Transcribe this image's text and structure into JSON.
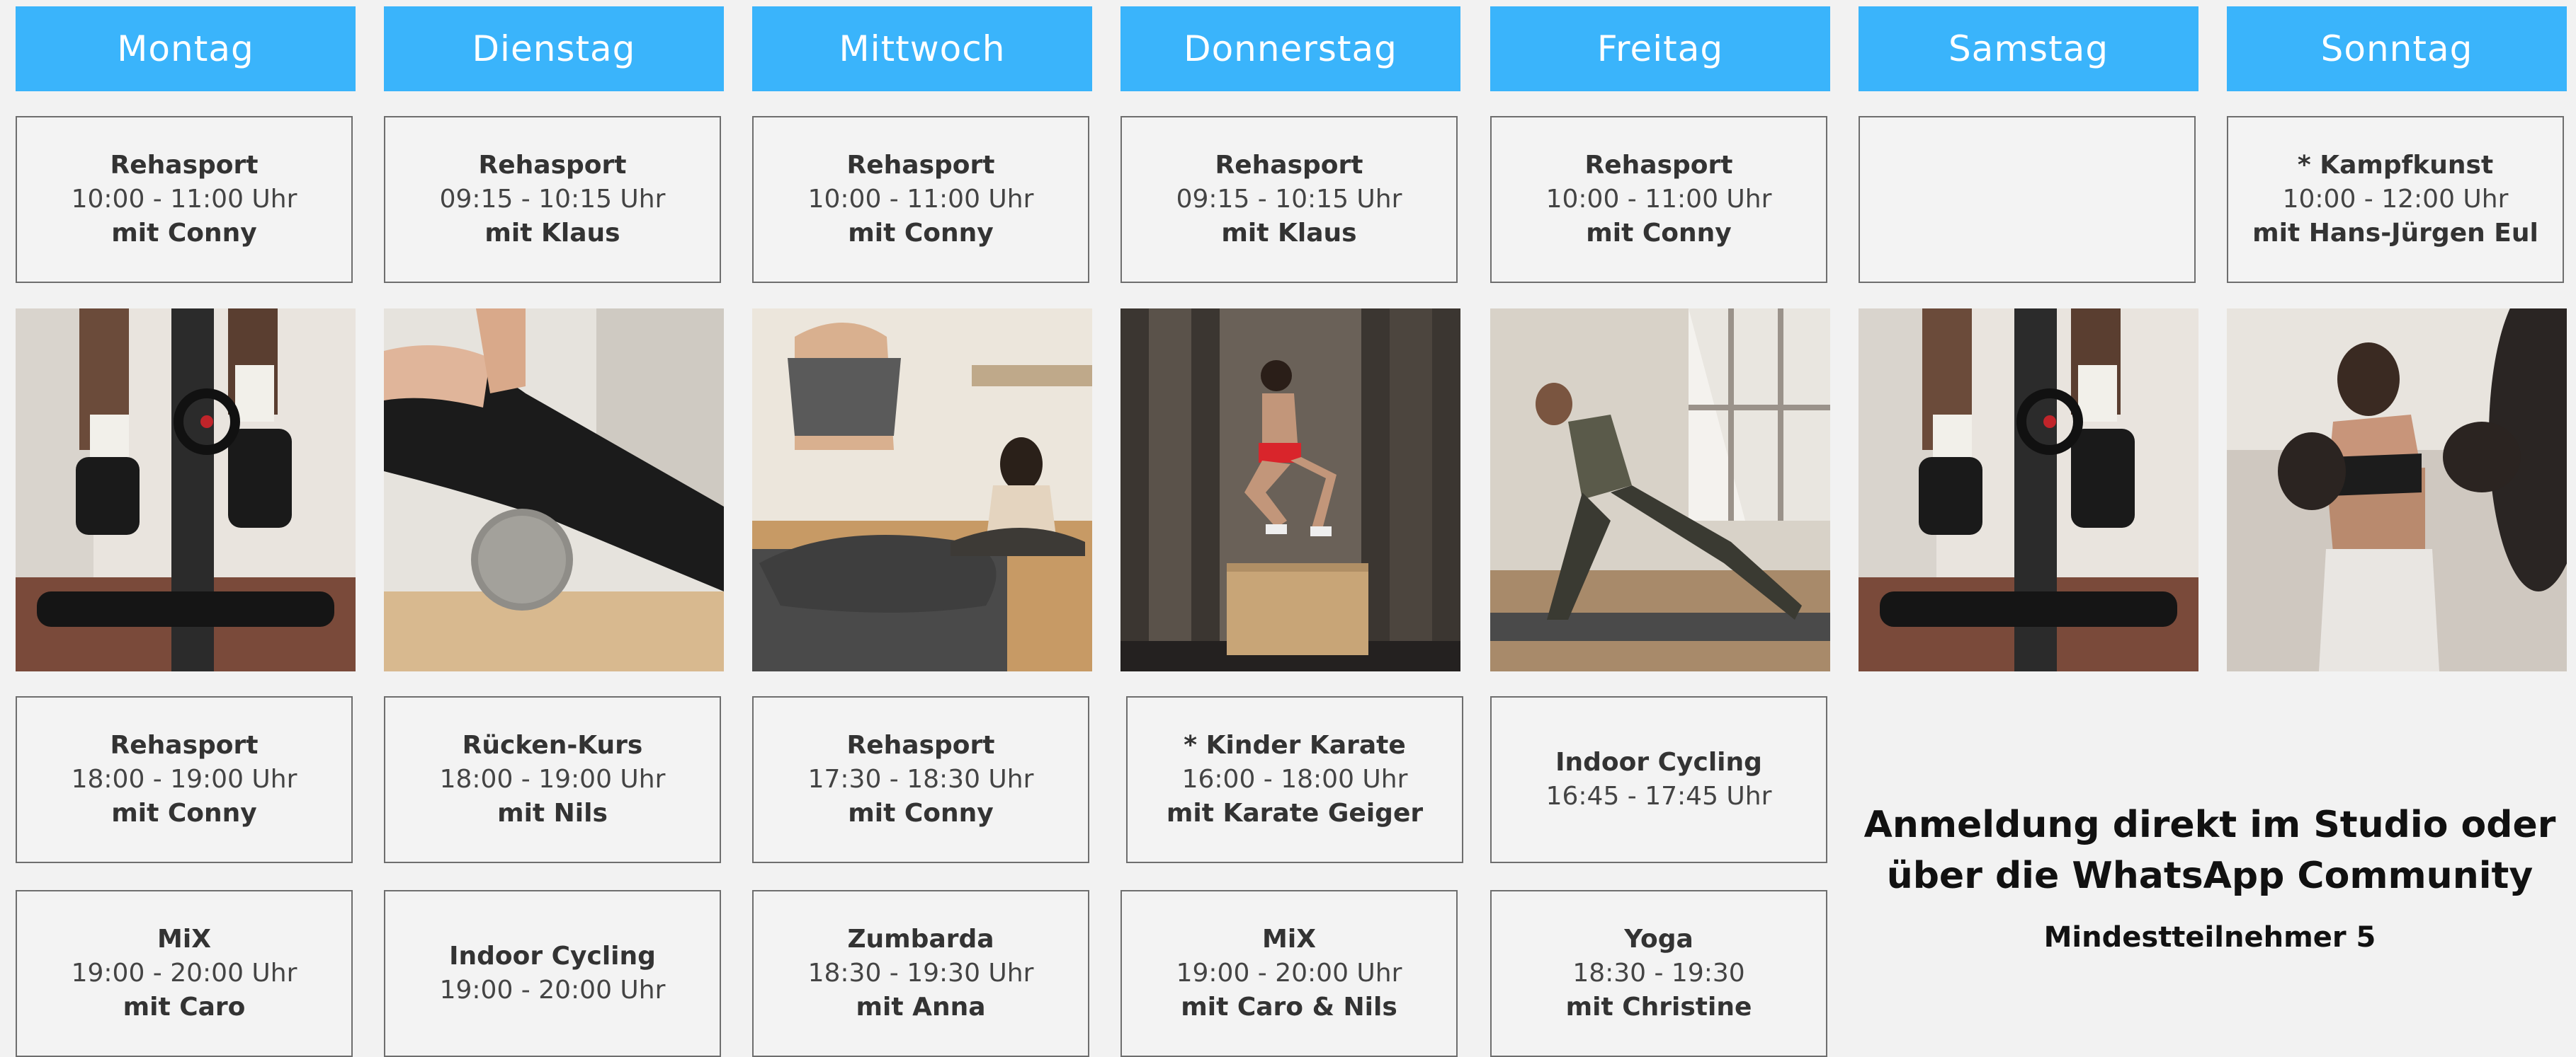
{
  "days": [
    {
      "name": "Montag"
    },
    {
      "name": "Dienstag"
    },
    {
      "name": "Mittwoch"
    },
    {
      "name": "Donnerstag"
    },
    {
      "name": "Freitag"
    },
    {
      "name": "Samstag"
    },
    {
      "name": "Sonntag"
    }
  ],
  "row1": [
    {
      "title": "Rehasport",
      "time": "10:00 - 11:00 Uhr",
      "with": "mit Conny"
    },
    {
      "title": "Rehasport",
      "time": "09:15 - 10:15 Uhr",
      "with": "mit Klaus"
    },
    {
      "title": "Rehasport",
      "time": "10:00 - 11:00 Uhr",
      "with": "mit Conny"
    },
    {
      "title": "Rehasport",
      "time": "09:15 - 10:15 Uhr",
      "with": "mit Klaus"
    },
    {
      "title": "Rehasport",
      "time": "10:00 - 11:00 Uhr",
      "with": "mit Conny"
    },
    {
      "title": "",
      "time": "",
      "with": ""
    },
    {
      "title": "* Kampfkunst",
      "time": "10:00 - 12:00 Uhr",
      "with": "mit Hans-Jürgen Eul"
    }
  ],
  "row3": [
    {
      "title": "Rehasport",
      "time": "18:00 - 19:00 Uhr",
      "with": "mit Conny"
    },
    {
      "title": "Rücken-Kurs",
      "time": "18:00 - 19:00 Uhr",
      "with": "mit Nils"
    },
    {
      "title": "Rehasport",
      "time": "17:30 - 18:30 Uhr",
      "with": "mit Conny"
    },
    {
      "title": "* Kinder Karate",
      "time": "16:00 - 18:00 Uhr",
      "with": "mit Karate Geiger"
    },
    {
      "title": "Indoor Cycling",
      "time": "16:45 - 17:45 Uhr",
      "with": ""
    }
  ],
  "row4": [
    {
      "title": "MiX",
      "time": "19:00 - 20:00 Uhr",
      "with": "mit Caro"
    },
    {
      "title": "Indoor Cycling",
      "time": "19:00 - 20:00 Uhr",
      "with": ""
    },
    {
      "title": "Zumbarda",
      "time": "18:30 - 19:30 Uhr",
      "with": "mit Anna"
    },
    {
      "title": "MiX",
      "time": "19:00 - 20:00 Uhr",
      "with": "mit Caro & Nils"
    },
    {
      "title": "Yoga",
      "time": "18:30 - 19:30",
      "with": "mit Christine"
    }
  ],
  "note": {
    "line1": "Anmeldung direkt im Studio oder",
    "line2": "über die WhatsApp Community",
    "line3": "Mindestteilnehmer 5"
  },
  "colors": {
    "header": "#3ab4fb",
    "background": "#f2f2f2"
  }
}
